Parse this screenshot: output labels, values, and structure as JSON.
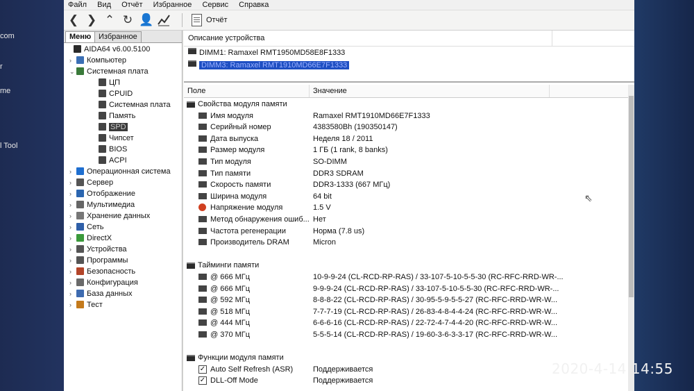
{
  "desktop": {
    "labels": [
      "com",
      "r",
      "me",
      "l Tool"
    ]
  },
  "menu": [
    "Файл",
    "Вид",
    "Отчёт",
    "Избранное",
    "Сервис",
    "Справка"
  ],
  "toolbar": {
    "report_label": "Отчёт"
  },
  "left_panel": {
    "tabs": [
      "Меню",
      "Избранное"
    ],
    "tree": [
      {
        "label": "AIDA64 v6.00.5100",
        "level": 0,
        "icon": "aida-icon",
        "color": "#2a2a2a"
      },
      {
        "label": "Компьютер",
        "level": 1,
        "icon": "computer-icon",
        "color": "#3b6fb5"
      },
      {
        "label": "Системная плата",
        "level": 1,
        "icon": "motherboard-icon",
        "color": "#3a7a3a",
        "expanded": true
      },
      {
        "label": "ЦП",
        "level": 2,
        "icon": "cpu-icon",
        "color": "#444"
      },
      {
        "label": "CPUID",
        "level": 2,
        "icon": "cpuid-icon",
        "color": "#444"
      },
      {
        "label": "Системная плата",
        "level": 2,
        "icon": "board-icon",
        "color": "#444"
      },
      {
        "label": "Память",
        "level": 2,
        "icon": "memory-icon",
        "color": "#444"
      },
      {
        "label": "SPD",
        "level": 2,
        "icon": "spd-icon",
        "color": "#444",
        "selected": true
      },
      {
        "label": "Чипсет",
        "level": 2,
        "icon": "chipset-icon",
        "color": "#444"
      },
      {
        "label": "BIOS",
        "level": 2,
        "icon": "bios-icon",
        "color": "#444"
      },
      {
        "label": "ACPI",
        "level": 2,
        "icon": "acpi-icon",
        "color": "#444"
      },
      {
        "label": "Операционная система",
        "level": 1,
        "icon": "windows-icon",
        "color": "#1f6fd0"
      },
      {
        "label": "Сервер",
        "level": 1,
        "icon": "server-icon",
        "color": "#555"
      },
      {
        "label": "Отображение",
        "level": 1,
        "icon": "display-icon",
        "color": "#2b66b0"
      },
      {
        "label": "Мультимедиа",
        "level": 1,
        "icon": "multimedia-icon",
        "color": "#666"
      },
      {
        "label": "Хранение данных",
        "level": 1,
        "icon": "storage-icon",
        "color": "#777"
      },
      {
        "label": "Сеть",
        "level": 1,
        "icon": "network-icon",
        "color": "#2f5fa8"
      },
      {
        "label": "DirectX",
        "level": 1,
        "icon": "directx-icon",
        "color": "#3b9a3b"
      },
      {
        "label": "Устройства",
        "level": 1,
        "icon": "devices-icon",
        "color": "#555"
      },
      {
        "label": "Программы",
        "level": 1,
        "icon": "programs-icon",
        "color": "#555"
      },
      {
        "label": "Безопасность",
        "level": 1,
        "icon": "security-icon",
        "color": "#b3452a"
      },
      {
        "label": "Конфигурация",
        "level": 1,
        "icon": "config-icon",
        "color": "#6a6a6a"
      },
      {
        "label": "База данных",
        "level": 1,
        "icon": "database-icon",
        "color": "#3e6bb0"
      },
      {
        "label": "Тест",
        "level": 1,
        "icon": "test-icon",
        "color": "#c47a1c"
      }
    ]
  },
  "device_panel": {
    "header": "Описание устройства",
    "devices": [
      {
        "label": "DIMM1: Ramaxel RMT1950MD58E8F1333"
      },
      {
        "label": "DIMM3: Ramaxel RMT1910MD66E7F1333",
        "selected": true
      }
    ]
  },
  "grid": {
    "columns": [
      "Поле",
      "Значение"
    ],
    "rows": [
      {
        "kind": "group",
        "field": "Свойства модуля памяти"
      },
      {
        "kind": "item",
        "field": "Имя модуля",
        "value": "Ramaxel RMT1910MD66E7F1333"
      },
      {
        "kind": "item",
        "field": "Серийный номер",
        "value": "4383580Bh (190350147)"
      },
      {
        "kind": "item",
        "field": "Дата выпуска",
        "value": "Неделя 18 / 2011"
      },
      {
        "kind": "item",
        "field": "Размер модуля",
        "value": "1 ГБ (1 rank, 8 banks)"
      },
      {
        "kind": "item",
        "field": "Тип модуля",
        "value": "SO-DIMM"
      },
      {
        "kind": "item",
        "field": "Тип памяти",
        "value": "DDR3 SDRAM"
      },
      {
        "kind": "item",
        "field": "Скорость памяти",
        "value": "DDR3-1333 (667 МГц)"
      },
      {
        "kind": "item",
        "field": "Ширина модуля",
        "value": "64 bit"
      },
      {
        "kind": "item",
        "field": "Напряжение модуля",
        "value": "1.5 V",
        "icon": "voltage-icon"
      },
      {
        "kind": "item",
        "field": "Метод обнаружения ошиб...",
        "value": "Нет"
      },
      {
        "kind": "item",
        "field": "Частота регенерации",
        "value": "Норма (7.8 us)"
      },
      {
        "kind": "item",
        "field": "Производитель DRAM",
        "value": "Micron"
      },
      {
        "kind": "blank"
      },
      {
        "kind": "group",
        "field": "Тайминги памяти"
      },
      {
        "kind": "item",
        "field": "@ 666 МГц",
        "value": "10-9-9-24  (CL-RCD-RP-RAS) / 33-107-5-10-5-5-30  (RC-RFC-RRD-WR-..."
      },
      {
        "kind": "item",
        "field": "@ 666 МГц",
        "value": "9-9-9-24  (CL-RCD-RP-RAS) / 33-107-5-10-5-5-30  (RC-RFC-RRD-WR-..."
      },
      {
        "kind": "item",
        "field": "@ 592 МГц",
        "value": "8-8-8-22  (CL-RCD-RP-RAS) / 30-95-5-9-5-5-27  (RC-RFC-RRD-WR-W..."
      },
      {
        "kind": "item",
        "field": "@ 518 МГц",
        "value": "7-7-7-19  (CL-RCD-RP-RAS) / 26-83-4-8-4-4-24  (RC-RFC-RRD-WR-W..."
      },
      {
        "kind": "item",
        "field": "@ 444 МГц",
        "value": "6-6-6-16  (CL-RCD-RP-RAS) / 22-72-4-7-4-4-20  (RC-RFC-RRD-WR-W..."
      },
      {
        "kind": "item",
        "field": "@ 370 МГц",
        "value": "5-5-5-14  (CL-RCD-RP-RAS) / 19-60-3-6-3-3-17  (RC-RFC-RRD-WR-W..."
      },
      {
        "kind": "blank"
      },
      {
        "kind": "group",
        "field": "Функции модуля памяти"
      },
      {
        "kind": "check",
        "field": "Auto Self Refresh (ASR)",
        "value": "Поддерживается"
      },
      {
        "kind": "check",
        "field": "DLL-Off Mode",
        "value": "Поддерживается"
      }
    ]
  },
  "timestamp": "2020-4-14  14:55"
}
